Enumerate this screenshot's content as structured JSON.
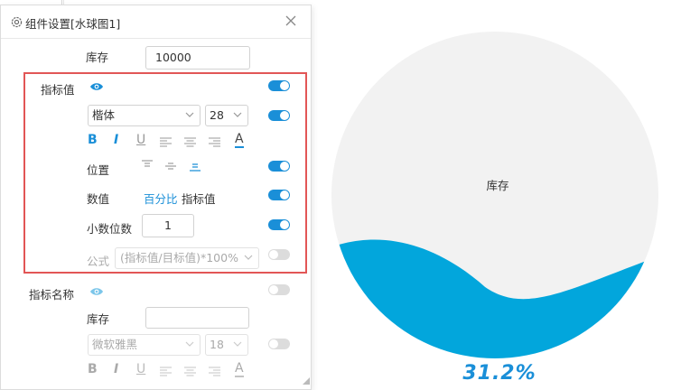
{
  "window": {
    "title": "组件设置[水球图1]"
  },
  "stock": {
    "label": "库存",
    "value": "10000"
  },
  "indicator_value": {
    "label": "指标值",
    "font": {
      "family": "楷体",
      "size": "28"
    },
    "position_label": "位置",
    "value_label": "数值",
    "value_options": [
      "百分比",
      "指标值"
    ],
    "decimals_label": "小数位数",
    "decimals_value": "1",
    "formula_label": "公式",
    "formula_value": "(指标值/目标值)*100%"
  },
  "indicator_name": {
    "label": "指标名称",
    "name_label": "库存",
    "name_value": "",
    "font": {
      "family": "微软雅黑",
      "size": "18"
    }
  },
  "format_glyphs": {
    "bold": "B",
    "italic": "I",
    "underline": "U",
    "color": "A"
  },
  "chart_data": {
    "type": "liquidfill",
    "name": "库存",
    "percent_label": "31.2%",
    "value": 0.312
  },
  "colors": {
    "accent": "#1a8fd8",
    "wave": "#02a6dc",
    "bubble": "#f2f2f2",
    "highlight_box": "#e25656"
  }
}
